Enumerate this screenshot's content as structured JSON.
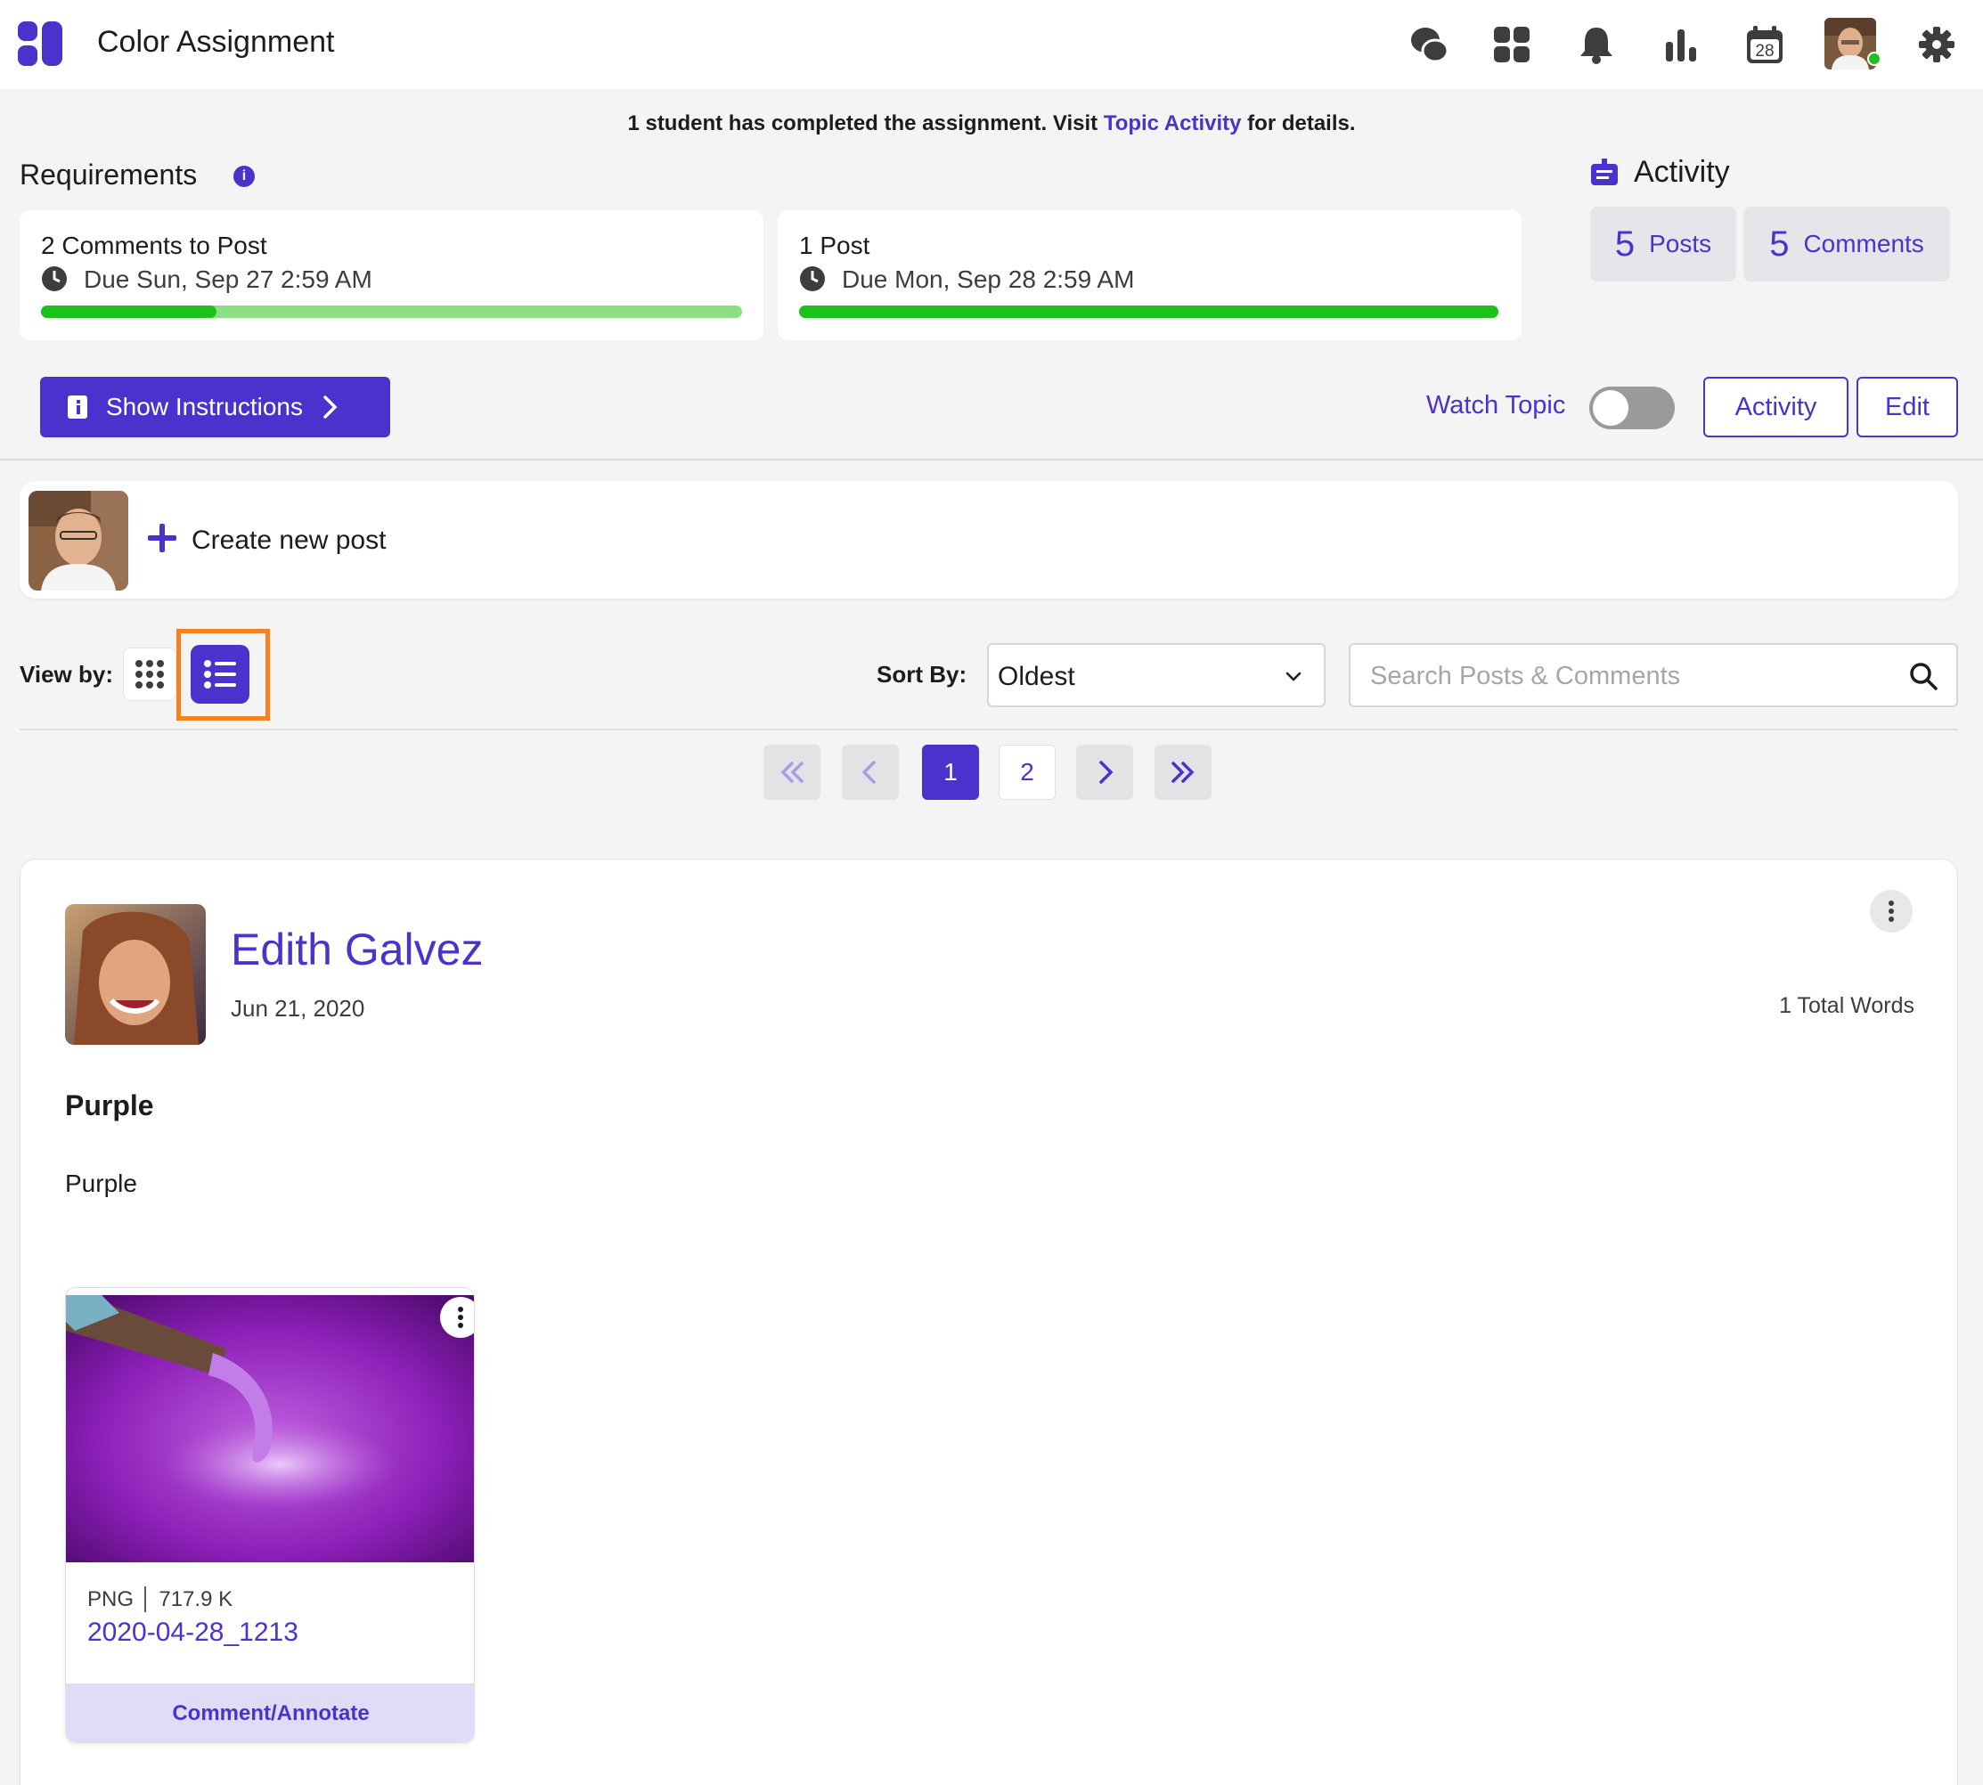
{
  "app": {
    "title": "Color Assignment"
  },
  "header": {
    "nav_icons": [
      "chat-icon",
      "apps-grid-icon",
      "bell-icon",
      "analytics-icon",
      "calendar-icon",
      "settings-icon"
    ],
    "calendar_day": "28"
  },
  "banner": {
    "prefix": "1 student has completed the assignment. Visit ",
    "link": "Topic Activity",
    "suffix": " for details."
  },
  "requirements": {
    "title": "Requirements",
    "info": "i",
    "items": [
      {
        "title": "2 Comments to Post",
        "due": "Due Sun, Sep 27 2:59 AM",
        "progress": 0.25
      },
      {
        "title": "1 Post",
        "due": "Due Mon, Sep 28 2:59 AM",
        "progress": 1.0
      }
    ]
  },
  "activity": {
    "title": "Activity",
    "posts_count": "5",
    "posts_label": "Posts",
    "comments_count": "5",
    "comments_label": "Comments"
  },
  "toolbar": {
    "show_instructions": "Show Instructions",
    "watch_topic": "Watch Topic",
    "watch_on": false,
    "activity_button": "Activity",
    "edit_button": "Edit"
  },
  "create_post": {
    "label": "Create new post"
  },
  "view": {
    "view_by_label": "View by:",
    "sort_by_label": "Sort By:",
    "sort_value": "Oldest",
    "search_placeholder": "Search Posts & Comments"
  },
  "pagination": {
    "pages": [
      "1",
      "2"
    ],
    "current": "1"
  },
  "post": {
    "author": "Edith Galvez",
    "date": "Jun 21, 2020",
    "word_count": "1 Total Words",
    "title": "Purple",
    "body": "Purple",
    "attachment": {
      "type": "PNG",
      "size": "717.9 K",
      "name": "2020-04-28_1213",
      "action": "Comment/Annotate"
    }
  },
  "colors": {
    "accent": "#4a33cc",
    "progress_done": "#1ec01b",
    "progress_track": "#8ddf86",
    "highlight": "#f58220"
  }
}
